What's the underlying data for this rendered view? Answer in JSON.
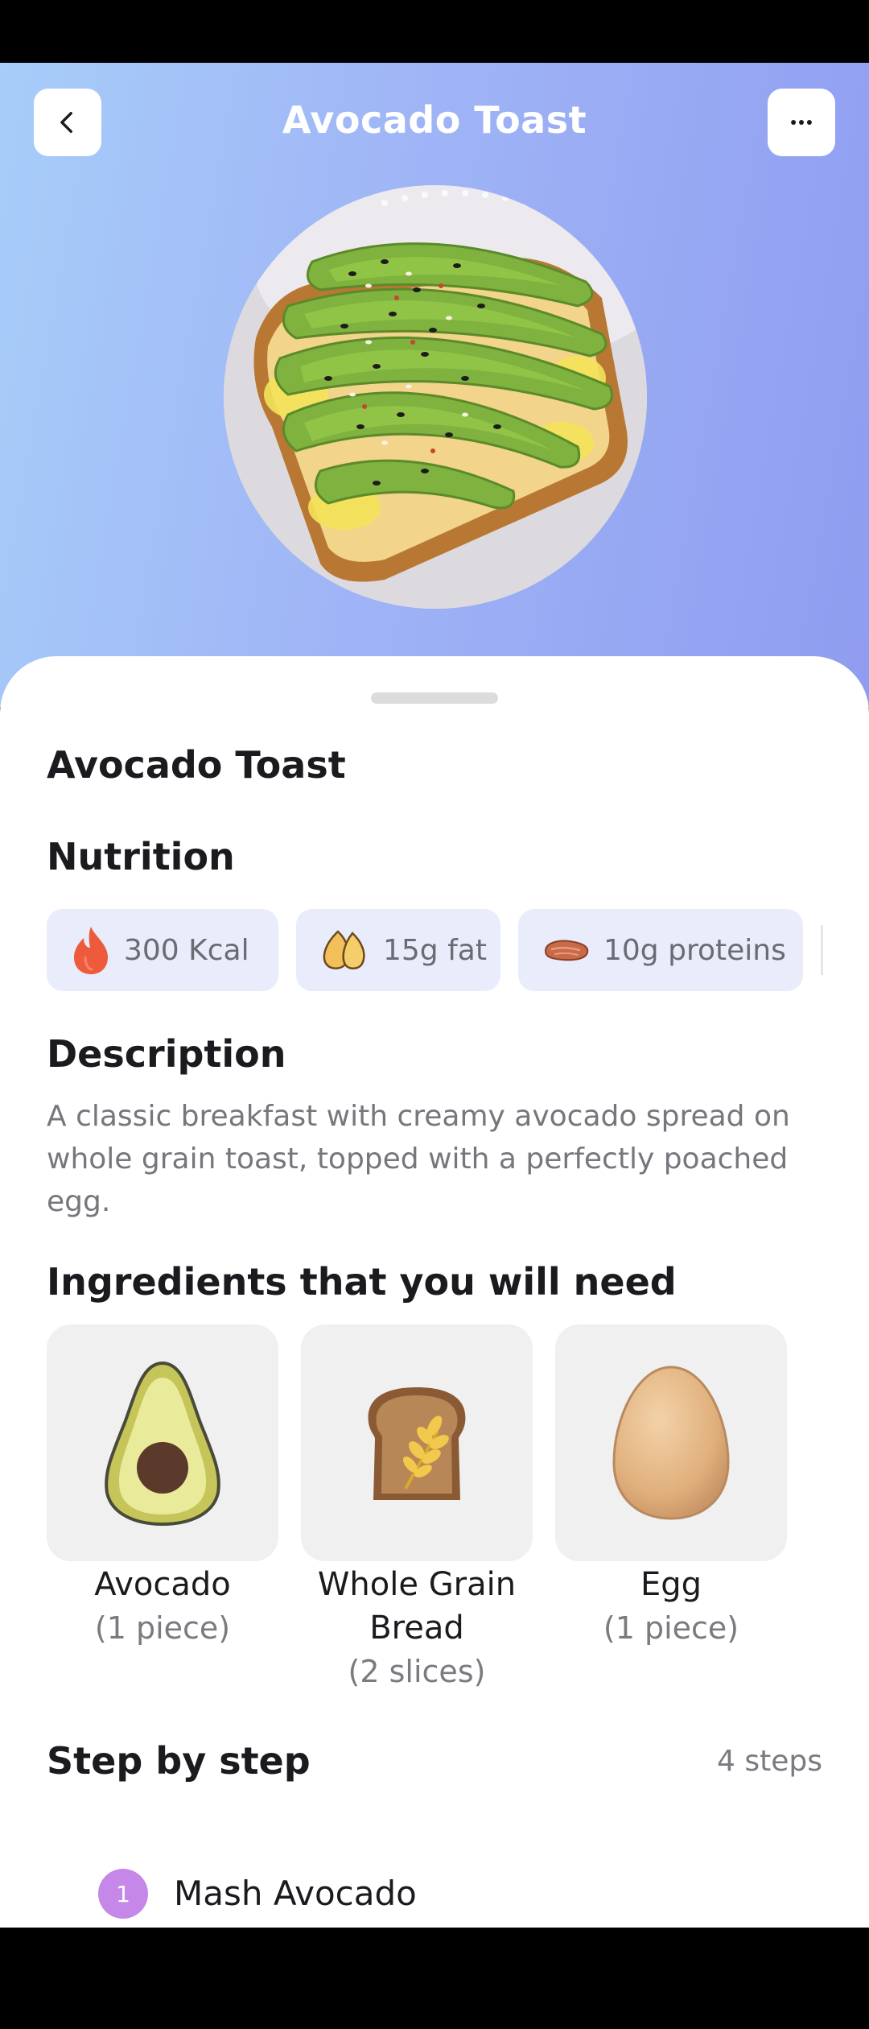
{
  "header": {
    "title": "Avocado Toast",
    "back_icon": "chevron-left-icon",
    "more_icon": "more-horizontal-icon"
  },
  "recipe": {
    "name": "Avocado Toast"
  },
  "nutrition": {
    "heading": "Nutrition",
    "chips": [
      {
        "icon": "flame-icon",
        "label": "300 Kcal"
      },
      {
        "icon": "fat-icon",
        "label": "15g fat"
      },
      {
        "icon": "protein-icon",
        "label": "10g proteins"
      }
    ]
  },
  "description": {
    "heading": "Description",
    "text": "A classic breakfast with creamy avocado spread on whole grain toast, topped with a perfectly poached egg."
  },
  "ingredients": {
    "heading": "Ingredients that you will need",
    "items": [
      {
        "name": "Avocado",
        "quantity": "(1 piece)",
        "icon": "avocado-icon"
      },
      {
        "name": "Whole Grain Bread",
        "quantity": "(2 slices)",
        "icon": "bread-icon"
      },
      {
        "name": "Egg",
        "quantity": "(1 piece)",
        "icon": "egg-icon"
      }
    ]
  },
  "steps": {
    "heading": "Step by step",
    "count": "4 steps",
    "items": [
      {
        "number": "1",
        "title": "Mash Avocado"
      }
    ]
  },
  "colors": {
    "hero_gradient_start": "#a7cdf9",
    "hero_gradient_end": "#8f9cf0",
    "chip_background": "#e9ecfb",
    "step_badge": "#c587e8"
  }
}
